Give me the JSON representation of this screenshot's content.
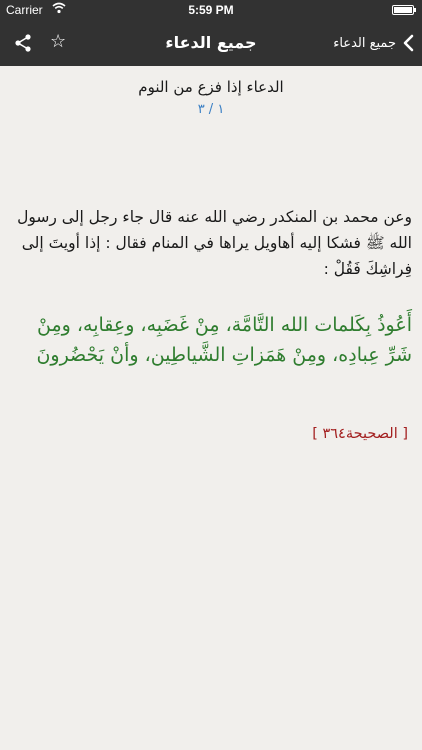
{
  "status_bar": {
    "carrier": "Carrier",
    "time": "5:59 PM"
  },
  "nav_bar": {
    "title": "جميع الدعاء",
    "back_label": "جميع الدعاء"
  },
  "content": {
    "dua_title": "الدعاء إذا فزع من النوم",
    "page_indicator": "١ / ٣",
    "narration": "وعن محمد بن المنكدر رضي الله عنه قال جاء رجل إلى رسول الله ﷺ فشكا إليه أهاويل يراها في المنام فقال : إذا أويتَ إلى فِراشِكَ فَقُلْ :",
    "dua_text": "أَعُوذُ بِكَلمات الله التَّامَّة، مِنْ غَضَبِه، وعِقابِه، ومِنْ شَرِّ عِبادِه، ومِنْ هَمَزاتِ الشَّياطِين، وأنْ يَحْضُرونَ",
    "source_ref": "[ الصحيحة٣٦٤ ]"
  },
  "colors": {
    "bar_background": "#323232",
    "page_background": "#f1efec",
    "page_indicator": "#3a7fc4",
    "dua_text": "#2f7d2f",
    "source_ref": "#a31f1f"
  },
  "icons": {
    "share": "share-icon",
    "star": "star-outline-icon",
    "back": "chevron-left-icon",
    "wifi": "wifi-icon",
    "battery": "battery-icon"
  }
}
